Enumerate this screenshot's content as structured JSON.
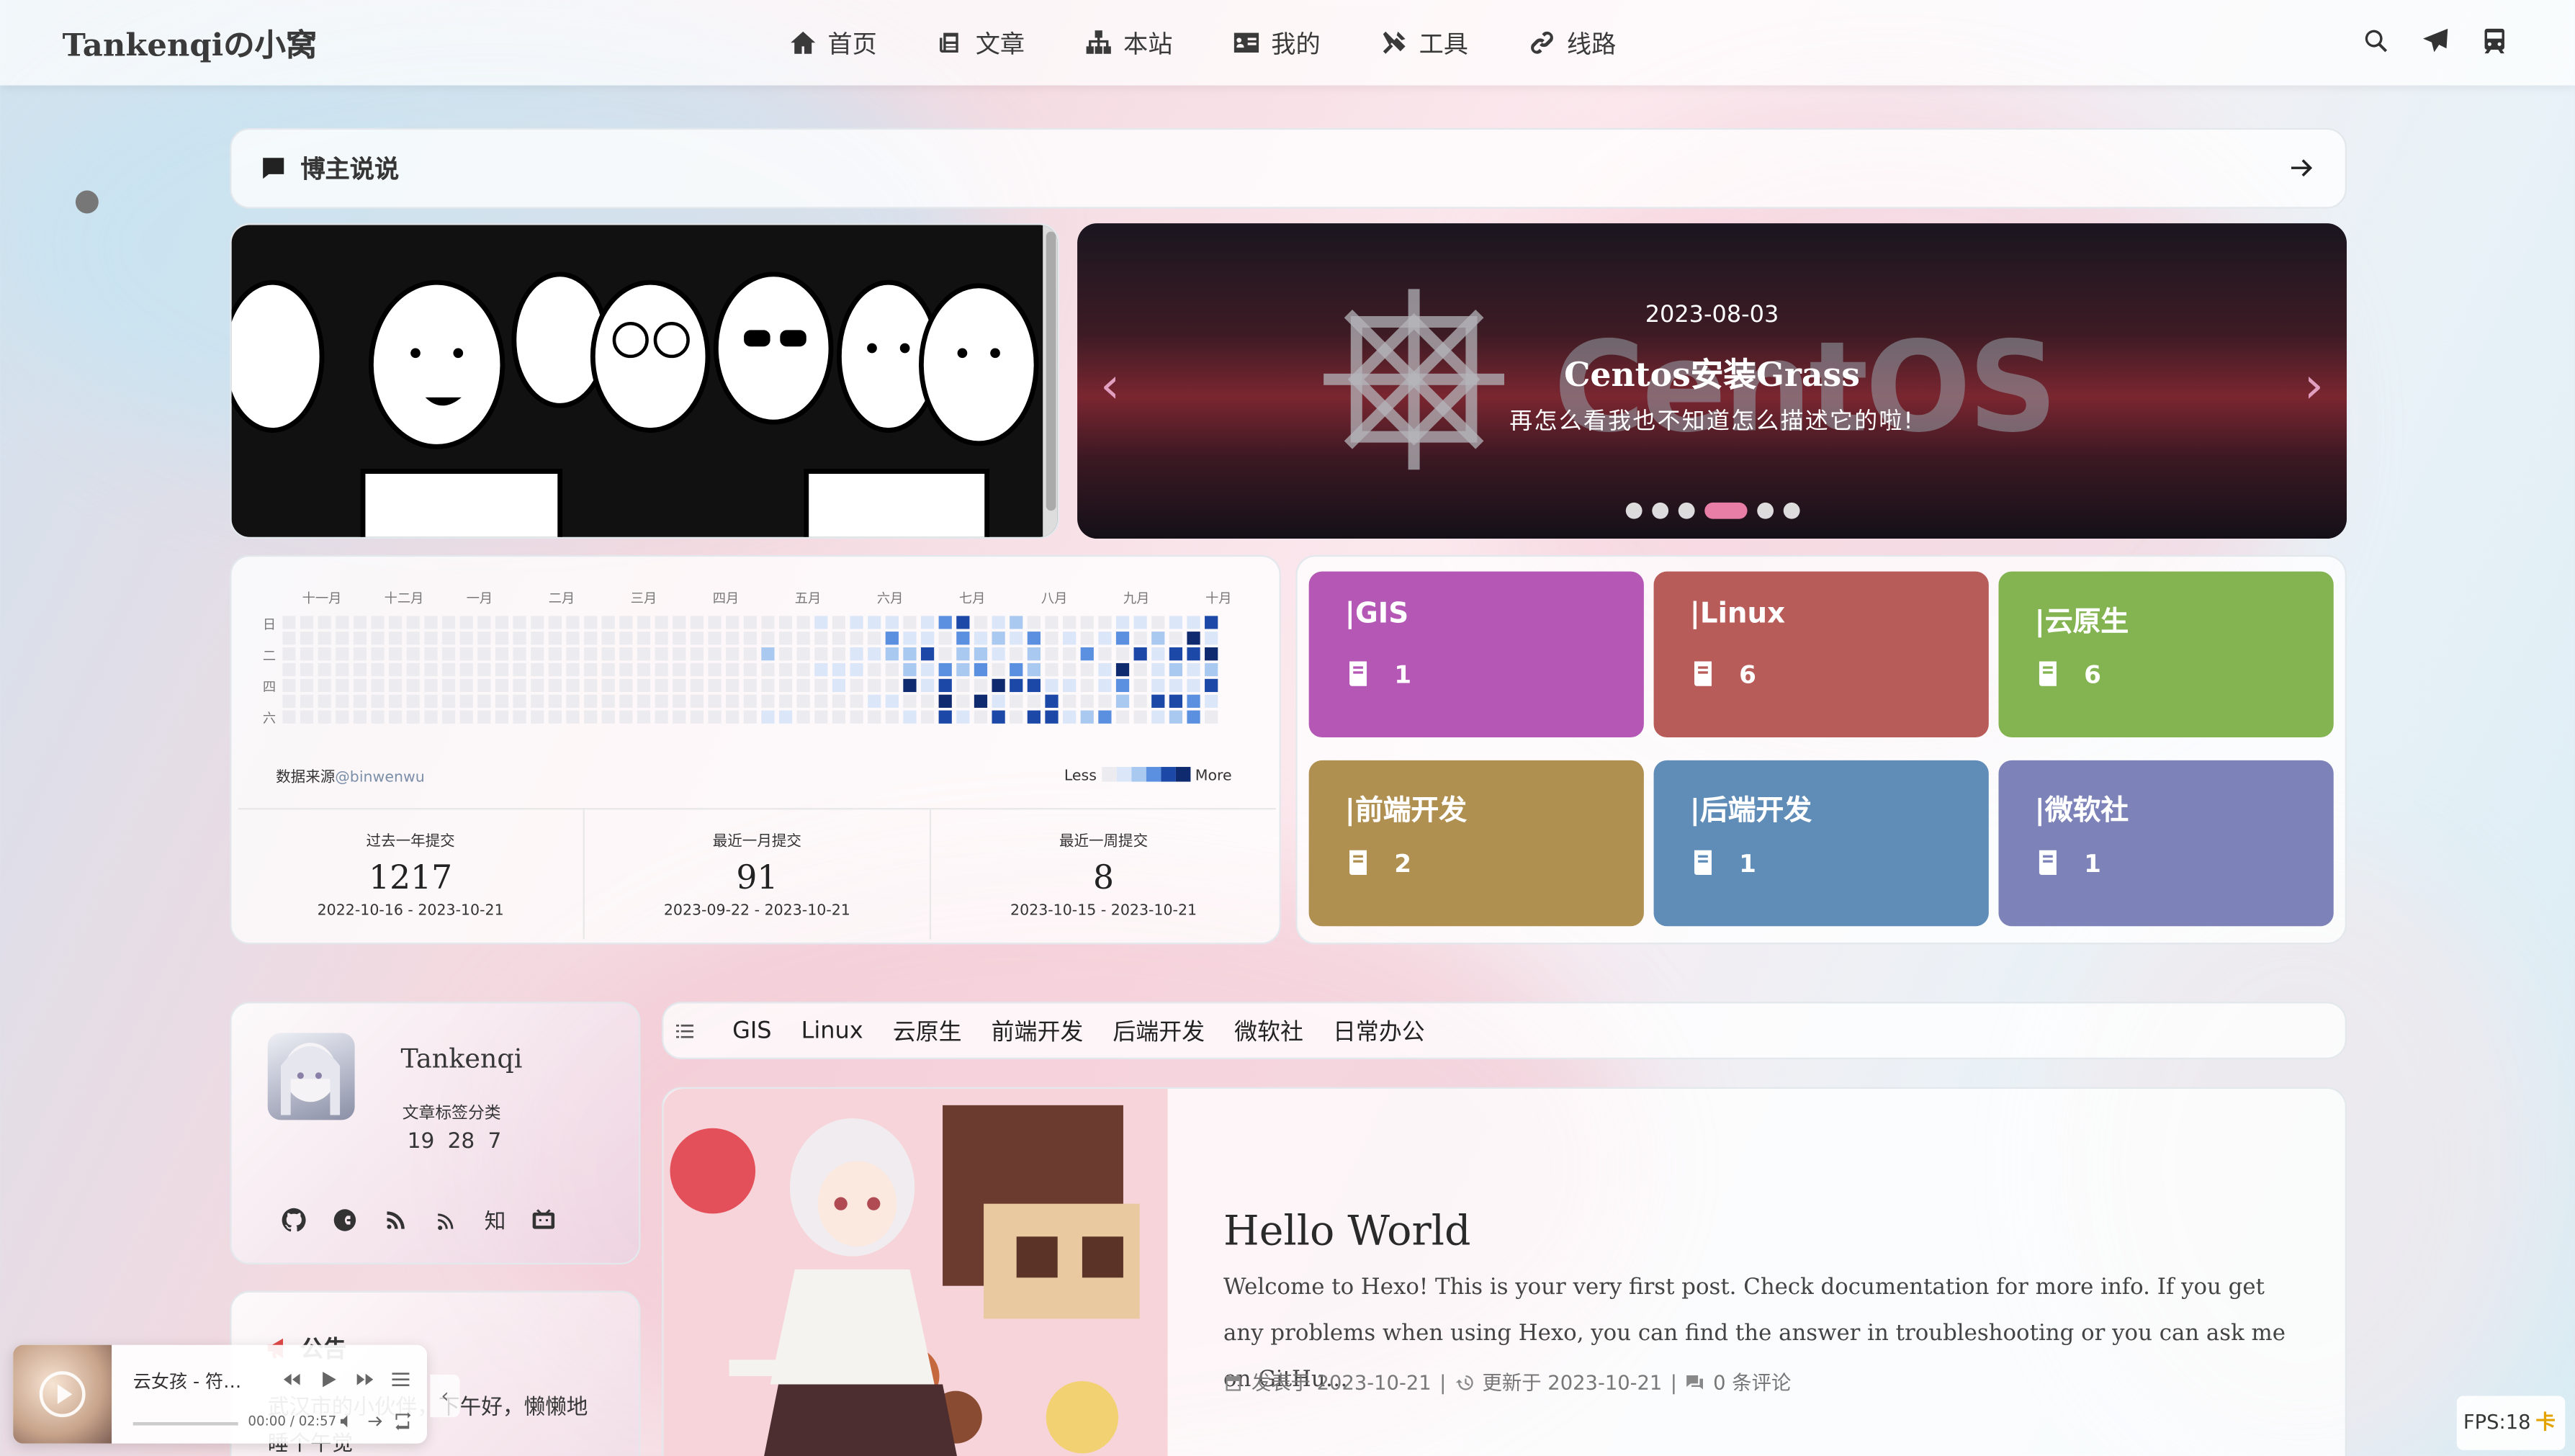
{
  "site": {
    "brand": "Tankenqiの小窝"
  },
  "nav": [
    {
      "label": "首页",
      "icon": "home-icon"
    },
    {
      "label": "文章",
      "icon": "newspaper-icon"
    },
    {
      "label": "本站",
      "icon": "sitemap-icon"
    },
    {
      "label": "我的",
      "icon": "id-card-icon"
    },
    {
      "label": "工具",
      "icon": "tools-icon"
    },
    {
      "label": "线路",
      "icon": "link-icon"
    }
  ],
  "nav_right": [
    "search-icon",
    "paper-plane-icon",
    "train-icon"
  ],
  "shuoshuo": {
    "label": "博主说说"
  },
  "banner": {
    "date": "2023-08-03",
    "title": "Centos安装Grass",
    "desc": "再怎么看我也不知道怎么描述它的啦!",
    "watermark": "CentOS",
    "slides": 6,
    "active_slide": 4
  },
  "github": {
    "months": [
      "十一月",
      "十二月",
      "一月",
      "二月",
      "三月",
      "四月",
      "五月",
      "六月",
      "七月",
      "八月",
      "九月",
      "十月"
    ],
    "weekdays": [
      "日",
      "二",
      "四",
      "六"
    ],
    "source_label": "数据来源",
    "source_user": "@binwenwu",
    "legend_less": "Less",
    "legend_more": "More",
    "colors": [
      "#ececf0",
      "#dbe7f9",
      "#aac9f0",
      "#5b8fe0",
      "#1c48a8",
      "#0f2a6e"
    ],
    "stats": [
      {
        "title": "过去一年提交",
        "num": "1217",
        "range": "2022-10-16 - 2023-10-21"
      },
      {
        "title": "最近一月提交",
        "num": "91",
        "range": "2023-09-22 - 2023-10-21"
      },
      {
        "title": "最近一周提交",
        "num": "8",
        "range": "2023-10-15 - 2023-10-21"
      }
    ]
  },
  "categories": [
    {
      "name": "|GIS",
      "count": "1",
      "color": "#b457b5"
    },
    {
      "name": "|Linux",
      "count": "6",
      "color": "#b85c59"
    },
    {
      "name": "|云原生",
      "count": "6",
      "color": "#84b351"
    },
    {
      "name": "|前端开发",
      "count": "2",
      "color": "#b09050"
    },
    {
      "name": "|后端开发",
      "count": "1",
      "color": "#5f8db8"
    },
    {
      "name": "|微软社",
      "count": "1",
      "color": "#7d83b8"
    }
  ],
  "author": {
    "name": "Tankenqi",
    "label": "文章标签分类",
    "articles": "19",
    "tags": "28",
    "categories": "7",
    "zhi": "知",
    "icons": [
      "github-icon",
      "csdn-icon",
      "rss-icon",
      "feed-icon",
      "zhihu-icon",
      "bilibili-icon"
    ]
  },
  "notice": {
    "title": "公告",
    "text": "武汉市的小伙伴，下午好，懒懒地睡个午觉"
  },
  "player": {
    "song": "云女孩 - 符…",
    "time": "00:00 / 02:57"
  },
  "tags": [
    "GIS",
    "Linux",
    "云原生",
    "前端开发",
    "后端开发",
    "微软社",
    "日常办公"
  ],
  "post": {
    "title": "Hello World",
    "excerpt": "Welcome to Hexo! This is your very first post. Check documentation for more info. If you get any problems when using Hexo, you can find the answer in troubleshooting or you can ask me on GitHu…",
    "published": "发表于 2023-10-21",
    "updated": "更新于 2023-10-21",
    "comments": "0 条评论",
    "sep": "|"
  },
  "fps": {
    "label": "FPS:18",
    "badge": "卡"
  }
}
